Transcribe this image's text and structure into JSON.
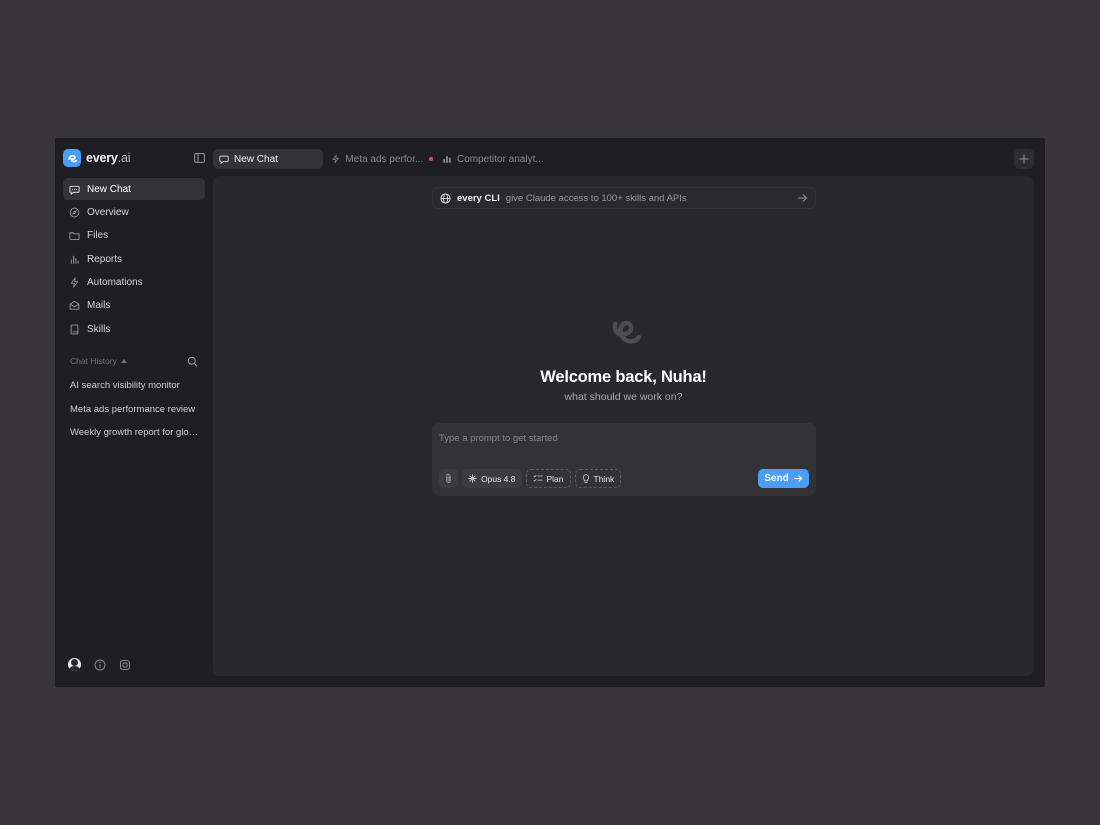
{
  "brand": {
    "name": "every",
    "suffix": ".ai"
  },
  "sidebar": {
    "nav": [
      {
        "label": "New Chat",
        "icon": "chat-bubble-icon",
        "active": true
      },
      {
        "label": "Overview",
        "icon": "compass-icon"
      },
      {
        "label": "Files",
        "icon": "folder-icon"
      },
      {
        "label": "Reports",
        "icon": "bar-chart-icon"
      },
      {
        "label": "Automations",
        "icon": "lightning-icon"
      },
      {
        "label": "Mails",
        "icon": "mail-icon"
      },
      {
        "label": "Skills",
        "icon": "book-icon"
      }
    ],
    "history_title": "Chat History",
    "history": [
      "AI search visibility monitor",
      "Meta ads performance review",
      "Weekly growth report for global"
    ],
    "footer_icons": [
      "avatar",
      "info-icon",
      "settings-icon"
    ]
  },
  "tabs": [
    {
      "label": "New Chat",
      "icon": "chat-bubble-icon",
      "active": true
    },
    {
      "label": "Meta ads perfor...",
      "icon": "lightning-icon",
      "unread": true
    },
    {
      "label": "Competitor analyt...",
      "icon": "bar-chart-icon"
    }
  ],
  "cli": {
    "name": "every CLI",
    "text": "give Claude access to 100+ skills and APIs"
  },
  "welcome": {
    "title": "Welcome back, Nuha!",
    "subtitle": "what should we work on?"
  },
  "composer": {
    "placeholder": "Type a prompt to get started",
    "model": "Opus 4.8",
    "plan": "Plan",
    "think": "Think",
    "send": "Send"
  },
  "colors": {
    "accent": "#4c9df5",
    "unread_dot": "#e5484d",
    "background": "#1f1e22",
    "panel": "#29282c"
  }
}
